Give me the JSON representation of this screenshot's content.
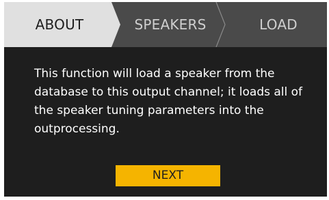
{
  "tabs": [
    {
      "label": "ABOUT",
      "active": true
    },
    {
      "label": "SPEAKERS",
      "active": false
    },
    {
      "label": "LOAD",
      "active": false
    }
  ],
  "content": {
    "description": "This function will load a speaker from the database to this output channel; it loads all of the speaker tuning parameters into the outprocessing."
  },
  "actions": {
    "next_label": "NEXT"
  },
  "colors": {
    "background": "#1e1e1e",
    "active_tab": "#e0e0e0",
    "inactive_tab": "#4a4a4a",
    "tab_divider": "#8a8a8a",
    "accent": "#f5b400",
    "text": "#ffffff"
  }
}
